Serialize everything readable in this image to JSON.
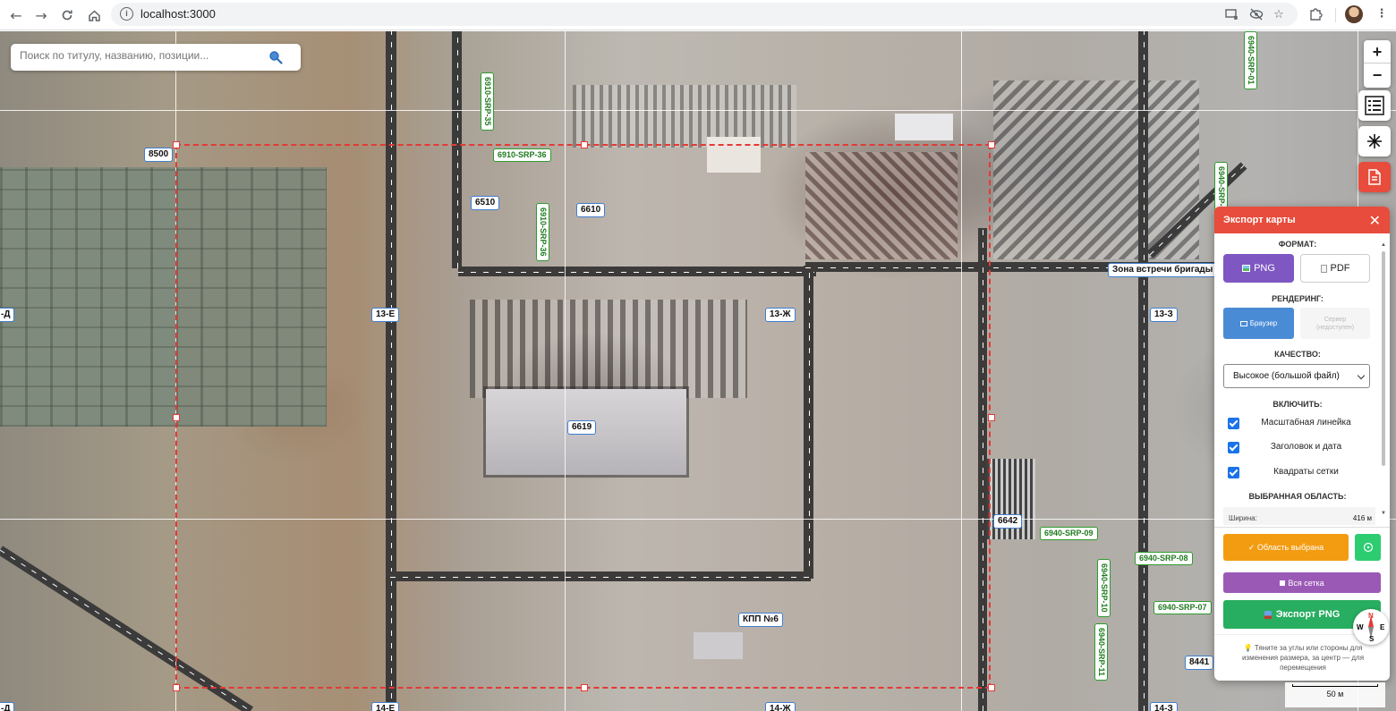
{
  "browser": {
    "url": "localhost:3000",
    "icons": [
      "back-icon",
      "forward-icon",
      "reload-icon",
      "home-icon",
      "site-info-icon",
      "install-icon",
      "eye-off-icon",
      "star-icon",
      "extensions-icon",
      "profile-avatar",
      "more-icon"
    ]
  },
  "search": {
    "placeholder": "Поиск по титулу, названию, позиции..."
  },
  "map_labels": {
    "l8500": "8500",
    "l6510": "6510",
    "l6610": "6610",
    "l6619": "6619",
    "l6642": "6642",
    "l8441": "8441",
    "l13e": "13-Е",
    "l13zh": "13-Ж",
    "l13z": "13-З",
    "l14e": "14-Е",
    "l14zh": "14-Ж",
    "l14z": "14-З",
    "ld1": "-Д",
    "ld2": "-Д",
    "kpp": "КПП №6",
    "zone": "Зона встречи бригады С",
    "srp35": "6910-SRP-35",
    "srp36h": "6910-SRP-36",
    "srp36v": "6910-SRP-36",
    "srp01": "6940-SRP-01",
    "srp06": "6940-SRP-06",
    "srp09": "6940-SRP-09",
    "srp08": "6940-SRP-08",
    "srp07": "6940-SRP-07",
    "srp10": "6940-SRP-10",
    "srp11": "6940-SRP-11"
  },
  "controls": {
    "zoom_in": "+",
    "zoom_out": "−"
  },
  "export_panel": {
    "title": "Экспорт карты",
    "close": "✕",
    "format_title": "ФОРМАТ:",
    "format_png": "PNG",
    "format_pdf": "PDF",
    "render_title": "РЕНДЕРИНГ:",
    "render_browser": "Браузер",
    "render_server": "Сервер (недоступен)",
    "quality_title": "КАЧЕСТВО:",
    "quality_value": "Высокое (большой файл)",
    "include_title": "ВКЛЮЧИТЬ:",
    "include_items": [
      "Масштабная линейка",
      "Заголовок и дата",
      "Квадраты сетки"
    ],
    "selected_area_title": "ВЫБРАННАЯ ОБЛАСТЬ:",
    "width_label": "Ширина:",
    "width_value": "416 м",
    "area_selected_btn": "✓ Область выбрана",
    "whole_grid_btn": "Вся сетка",
    "export_btn": "Экспорт PNG",
    "hint": "Тяните за углы или стороны для изменения размера, за центр — для перемещения",
    "colors": {
      "header": "#e74c3c",
      "png": "#7e57c2",
      "browser": "#4a8bd6",
      "area": "#f39c12",
      "green": "#2ecc71",
      "grid": "#9b59b6",
      "export": "#27ae60"
    }
  },
  "compass": {
    "n": "N",
    "w": "W",
    "e": "E",
    "s": "S"
  },
  "scale": {
    "label": "50 м"
  }
}
